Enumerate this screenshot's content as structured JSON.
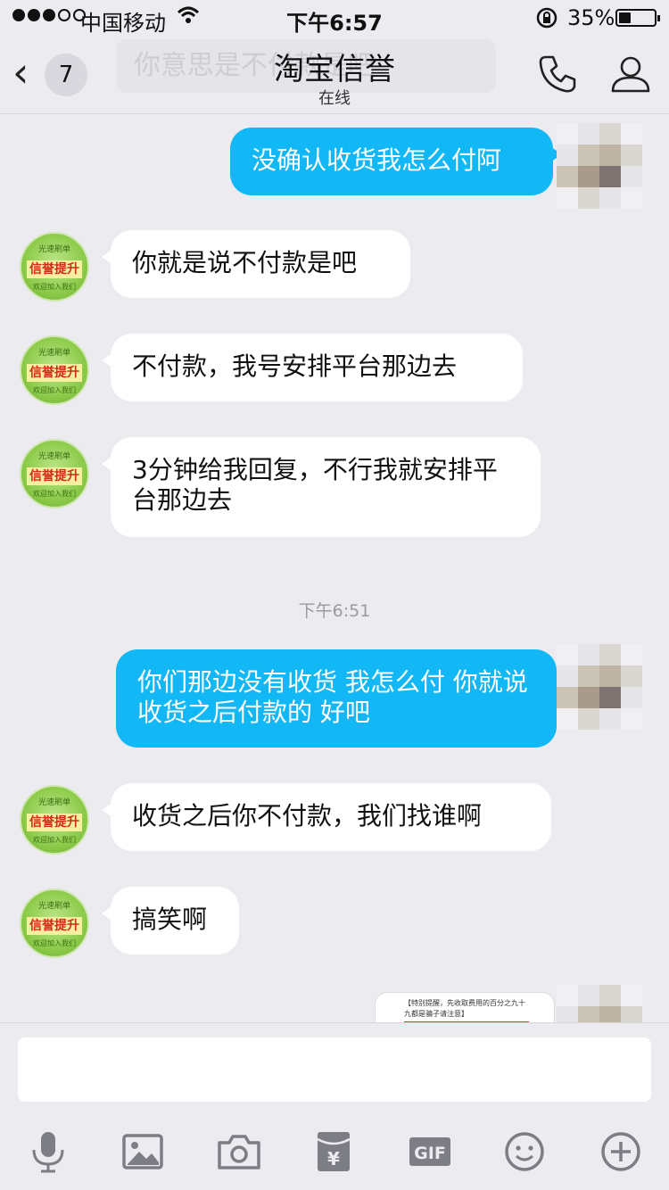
{
  "status_bar": {
    "carrier": "中国移动",
    "time": "下午6:57",
    "battery_percent": "35%",
    "battery_level": 0.35
  },
  "header": {
    "back_badge": "7",
    "ghost_preview": "你意思是不付款是吧",
    "title": "淘宝信誉",
    "subtitle": "在线",
    "icons": [
      "phone-icon",
      "profile-icon"
    ]
  },
  "avatar": {
    "top_text": "光速刷单",
    "band_text": "信誉提升",
    "bottom_text": "欢迎加入我们"
  },
  "messages": [
    {
      "side": "right",
      "text": "没确认收货我怎么付阿"
    },
    {
      "side": "left",
      "text": "你就是说不付款是吧"
    },
    {
      "side": "left",
      "text": "不付款，我号安排平台那边去"
    },
    {
      "side": "left",
      "text": "3分钟给我回复，不行我就安排平台那边去"
    },
    {
      "side": "right",
      "text": "你们那边没有收货  我怎么付  你就说  收货之后付款的  好吧"
    },
    {
      "side": "left",
      "text": "收货之后你不付款，我们找谁啊"
    },
    {
      "side": "left",
      "text": "搞笑啊"
    }
  ],
  "timestamp": "下午6:51",
  "partial_card": {
    "text": "【特别提醒，先收取费用的百分之九十九都是骗子请注意】"
  },
  "input": {
    "value": "",
    "placeholder": ""
  },
  "toolbar": {
    "icons": [
      "microphone-icon",
      "image-icon",
      "camera-icon",
      "red-packet-icon",
      "gif-icon",
      "emoji-icon",
      "plus-icon"
    ],
    "gif_label": "GIF",
    "yuan_label": "¥"
  },
  "colors": {
    "background": "#ebebf0",
    "outgoing_bubble": "#12b7f5",
    "incoming_bubble": "#ffffff",
    "icon_gray": "#7d7d86"
  }
}
